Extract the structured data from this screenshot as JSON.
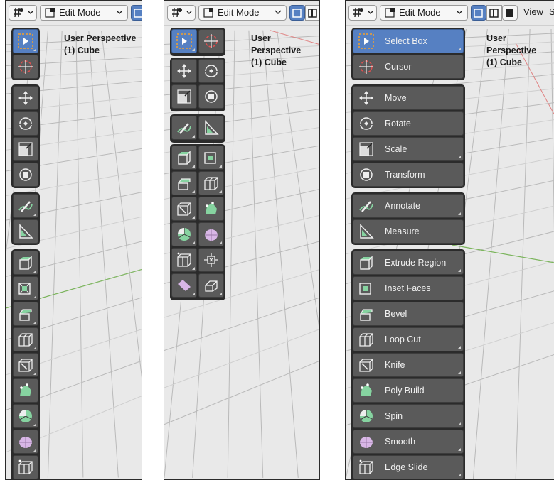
{
  "header": {
    "mode_label": "Edit Mode",
    "view_label": "View",
    "cut_label": "S"
  },
  "viewport": {
    "perspective": "User Perspective",
    "object": "(1) Cube"
  },
  "tools": [
    {
      "id": "select-box",
      "label": "Select Box",
      "icon": "select-box-icon",
      "active": true
    },
    {
      "id": "cursor",
      "label": "Cursor",
      "icon": "cursor-icon"
    },
    {
      "id": "move",
      "label": "Move",
      "icon": "move-icon"
    },
    {
      "id": "rotate",
      "label": "Rotate",
      "icon": "rotate-icon"
    },
    {
      "id": "scale",
      "label": "Scale",
      "icon": "scale-icon"
    },
    {
      "id": "transform",
      "label": "Transform",
      "icon": "transform-icon"
    },
    {
      "id": "annotate",
      "label": "Annotate",
      "icon": "annotate-icon"
    },
    {
      "id": "measure",
      "label": "Measure",
      "icon": "measure-icon"
    },
    {
      "id": "extrude-region",
      "label": "Extrude Region",
      "icon": "extrude-region-icon"
    },
    {
      "id": "inset-faces",
      "label": "Inset Faces",
      "icon": "inset-faces-icon"
    },
    {
      "id": "bevel",
      "label": "Bevel",
      "icon": "bevel-icon"
    },
    {
      "id": "loop-cut",
      "label": "Loop Cut",
      "icon": "loop-cut-icon"
    },
    {
      "id": "knife",
      "label": "Knife",
      "icon": "knife-icon"
    },
    {
      "id": "poly-build",
      "label": "Poly Build",
      "icon": "poly-build-icon"
    },
    {
      "id": "spin",
      "label": "Spin",
      "icon": "spin-icon"
    },
    {
      "id": "smooth",
      "label": "Smooth",
      "icon": "smooth-icon"
    },
    {
      "id": "edge-slide",
      "label": "Edge Slide",
      "icon": "edge-slide-icon"
    },
    {
      "id": "shrink-fatten",
      "label": "",
      "icon": "shrink-fatten-icon"
    },
    {
      "id": "shear",
      "label": "",
      "icon": "shear-icon"
    }
  ],
  "colors": {
    "active": "#5680c2",
    "button": "#5a5a5a",
    "toolbar_bg": "#2b2b2b",
    "icon_green": "#86d3a0",
    "icon_pink": "#d8b6e6"
  }
}
